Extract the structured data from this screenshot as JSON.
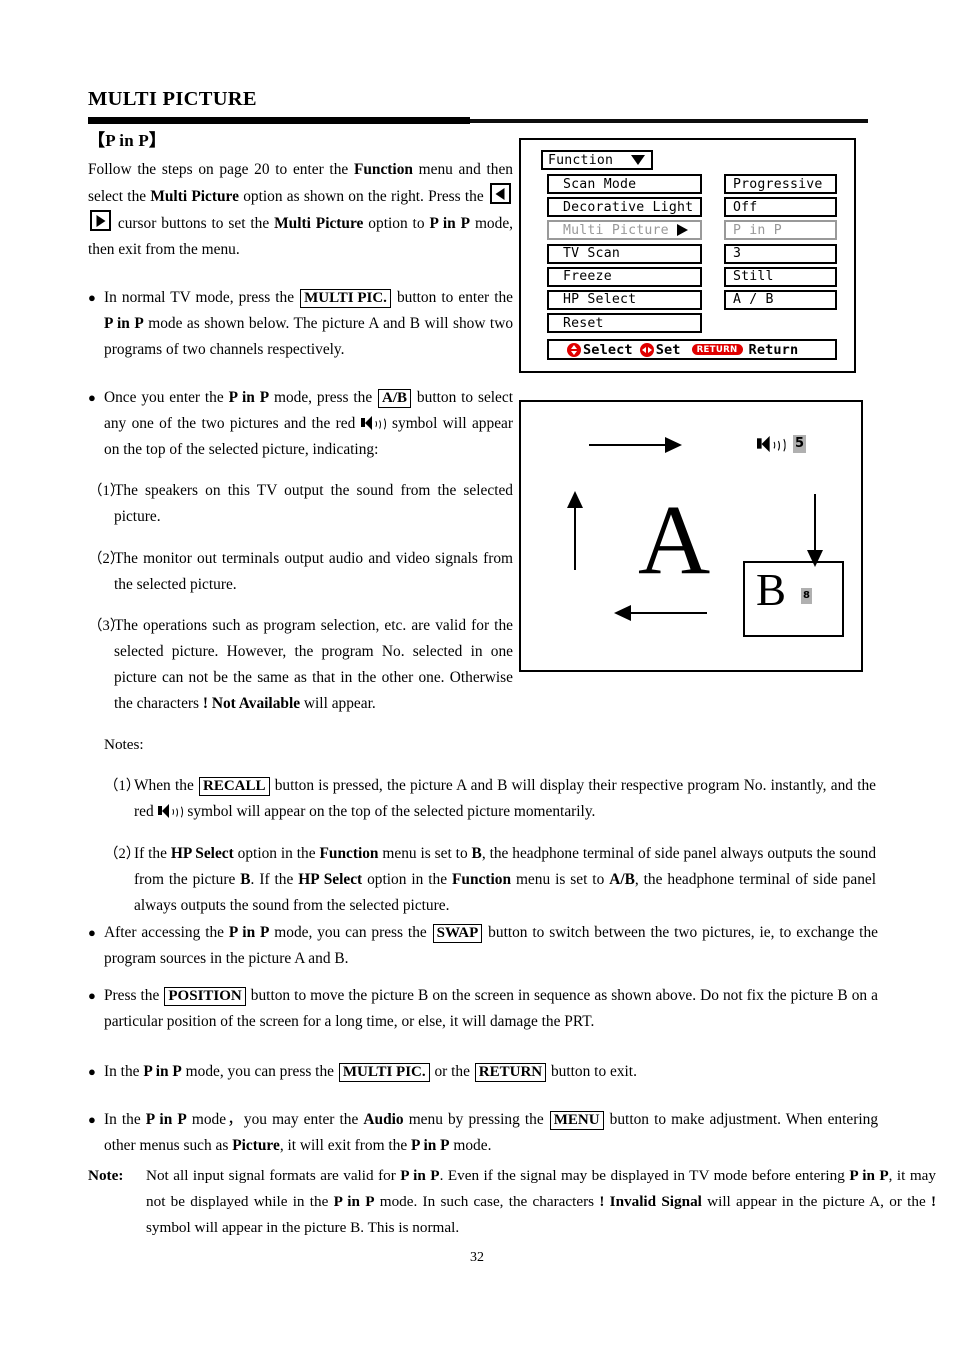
{
  "document": {
    "title": "MULTI PICTURE",
    "subhead": "【P in P】",
    "page_number": "32"
  },
  "intro": {
    "line_a": "Follow the steps on page 20 to enter the ",
    "bold_function": "Function",
    "line_b": " menu and then select the ",
    "bold_multi_picture": "Multi Picture",
    "line_c": " option as shown on the right. Press the ",
    "line_d": " cursor buttons to set the ",
    "bold_multi_picture2": "Multi Picture",
    "line_e": " option to ",
    "bold_pinp": "P in P",
    "line_f": " mode, then exit from the menu."
  },
  "bullets": {
    "b1_pre": "In normal TV mode, press the ",
    "b1_key": "MULTI PIC.",
    "b1_post": " button to enter the ",
    "b1_bold": "P in P",
    "b1_tail": " mode as shown below. The picture A and B will show two programs of two channels respectively.",
    "b2_pre": "Once you enter the ",
    "b2_bold": "P in P",
    "b2_mid": " mode, press the ",
    "b2_key": "A/B",
    "b2_post": " button to select any one of the two pictures and the red ",
    "b2_tail": " symbol will appear on the top of the selected picture, indicating:",
    "n1_num": "（1）",
    "n1_text": "The speakers on this TV output the sound from the selected picture.",
    "n2_num": "（2）",
    "n2_text": "The monitor out terminals output audio and video signals from the selected picture.",
    "n3_num": "（3）",
    "n3_pre": "The operations such as program selection, etc. are valid for the selected picture. However, the program No. selected in one picture can not be the same as that in the other one. Otherwise the characters ",
    "n3_bold": "! Not Available",
    "n3_post": " will appear."
  },
  "notes": {
    "heading": "Notes:",
    "n1_num": "（1）",
    "n1_pre": "When the ",
    "n1_key": "RECALL",
    "n1_mid": " button is pressed, the picture A and B will display their respective program No. instantly, and the red ",
    "n1_tail": " symbol will appear on the top of the selected picture momentarily.",
    "n2_num": "（2）",
    "n2_p1": "If the ",
    "n2_b1": "HP Select",
    "n2_p2": " option in the ",
    "n2_b2": "Function",
    "n2_p3": " menu is set to ",
    "n2_b3": "B",
    "n2_p4": ", the headphone terminal of side panel always outputs the sound from the picture ",
    "n2_b4": "B",
    "n2_p5": ". If the ",
    "n2_b5": "HP Select",
    "n2_p6": " option in the ",
    "n2_b6": "Function",
    "n2_p7": " menu is set to ",
    "n2_b7": "A/B",
    "n2_p8": ", the headphone terminal of side panel always outputs the sound from the selected picture."
  },
  "lower_bullets": {
    "swap_pre": "After accessing the ",
    "swap_bold": "P in P",
    "swap_mid": " mode, you can press the ",
    "swap_key": "SWAP",
    "swap_post": " button to switch between the two pictures, ie, to exchange the program sources in the picture A and B.",
    "pos_pre": "Press the ",
    "pos_key": "POSITION",
    "pos_post": " button to move the picture B on the screen in sequence as shown above. Do not fix the picture B on a particular position of the screen for a long time, or else, it will damage the PRT.",
    "exit_pre": "In the ",
    "exit_bold": "P in P",
    "exit_mid": " mode, you can press the ",
    "exit_key1": "MULTI PIC.",
    "exit_mid2": " or the ",
    "exit_key2": "RETURN",
    "exit_post": " button to exit.",
    "audio_pre": "In the ",
    "audio_bold": "P in P",
    "audio_mid": " mode，you may enter the ",
    "audio_b2": "Audio",
    "audio_mid2": " menu by pressing the ",
    "audio_key": "MENU",
    "audio_mid3": " button to make adjustment. When entering other menus such as ",
    "audio_b3": "Picture",
    "audio_mid4": ", it will exit from the ",
    "audio_b4": "P in P",
    "audio_post": " mode."
  },
  "final_note": {
    "label": "Note:",
    "p1": "Not all input signal formats are valid for ",
    "b1": "P in P",
    "p2": ". Even if the signal may be displayed in TV mode before entering ",
    "b2": "P in P",
    "p3": ", it may not be displayed while in the ",
    "b3": "P in P",
    "p4": " mode. In such case, the characters ",
    "b4": "! Invalid Signal",
    "p5": " will appear in the picture A, or the ",
    "b5": "!",
    "p6": " symbol will appear in the picture B. This is normal."
  },
  "osd": {
    "menu_title": "Function",
    "rows": [
      {
        "label": "Scan Mode",
        "value": "Progressive",
        "dim": false,
        "arrow": false
      },
      {
        "label": "Decorative Light",
        "value": "Off",
        "dim": false,
        "arrow": false
      },
      {
        "label": "Multi Picture",
        "value": "P in P",
        "dim": true,
        "arrow": true
      },
      {
        "label": "TV Scan",
        "value": "3",
        "dim": false,
        "arrow": false
      },
      {
        "label": "Freeze",
        "value": "Still",
        "dim": false,
        "arrow": false
      },
      {
        "label": "HP Select",
        "value": "A / B",
        "dim": false,
        "arrow": false
      },
      {
        "label": "Reset",
        "value": "",
        "dim": false,
        "arrow": false
      }
    ],
    "status": {
      "select_label": "Select",
      "set_label": "Set",
      "return_pill": "RETURN",
      "return_label": "Return"
    },
    "accent_color": "#e00000",
    "dim_color": "#999999"
  },
  "diagram": {
    "picture_a_letter": "A",
    "picture_a_program": "5",
    "picture_b_letter": "B",
    "picture_b_program": "8",
    "chip_color": "#b0b0b0"
  }
}
